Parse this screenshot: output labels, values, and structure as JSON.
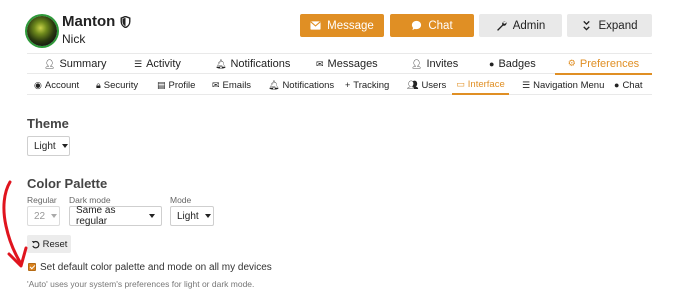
{
  "user": {
    "username": "Manton",
    "full_name": "Nick"
  },
  "header_buttons": {
    "message": "Message",
    "chat": "Chat",
    "admin": "Admin",
    "expand": "Expand"
  },
  "main_nav": [
    "Summary",
    "Activity",
    "Notifications",
    "Messages",
    "Invites",
    "Badges",
    "Preferences"
  ],
  "sub_nav": [
    "Account",
    "Security",
    "Profile",
    "Emails",
    "Notifications",
    "Tracking",
    "Users",
    "Interface",
    "Navigation Menu",
    "Chat"
  ],
  "theme": {
    "heading": "Theme",
    "value": "Light"
  },
  "color_palette": {
    "heading": "Color Palette",
    "regular_label": "Regular",
    "regular_value": "22",
    "dark_label": "Dark mode",
    "dark_value": "Same as regular",
    "mode_label": "Mode",
    "mode_value": "Light",
    "reset_label": "Reset",
    "checkbox_label": "Set default color palette and mode on all my devices",
    "checkbox_checked": true,
    "help_text": "'Auto' uses your system's preferences for light or dark mode."
  },
  "colors": {
    "accent": "#e08f24",
    "annotation": "#e0141e"
  }
}
